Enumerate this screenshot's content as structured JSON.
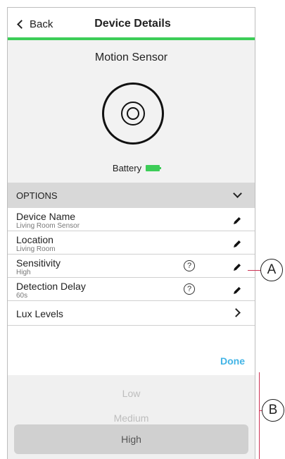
{
  "header": {
    "back_label": "Back",
    "title": "Device Details"
  },
  "device": {
    "name": "Motion Sensor",
    "battery_label": "Battery"
  },
  "options": {
    "section_label": "OPTIONS",
    "rows": [
      {
        "title": "Device Name",
        "subtitle": "Living Room Sensor"
      },
      {
        "title": "Location",
        "subtitle": "Living Room"
      },
      {
        "title": "Sensitivity",
        "subtitle": "High"
      },
      {
        "title": "Detection Delay",
        "subtitle": "60s"
      },
      {
        "title": "Lux Levels"
      }
    ]
  },
  "done_label": "Done",
  "picker": {
    "options": [
      "Low",
      "Medium",
      "High"
    ],
    "selected": "High"
  },
  "callouts": {
    "a": "A",
    "b": "B"
  },
  "colors": {
    "accent_green": "#3dcd58",
    "done_blue": "#42b4e6",
    "callout_line": "#cc3355"
  },
  "icons": {
    "back": "chevron-left-icon",
    "expand": "chevron-down-icon",
    "edit": "pencil-icon",
    "help": "help-circle-icon",
    "next": "chevron-right-icon",
    "battery": "battery-full-icon",
    "sensor": "motion-sensor-icon"
  }
}
